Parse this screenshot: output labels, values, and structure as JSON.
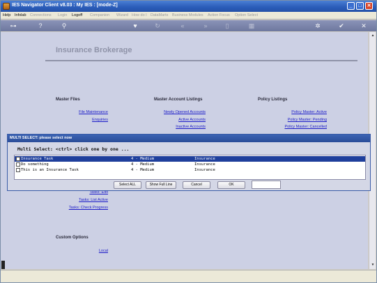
{
  "window": {
    "title": "IES Navigator Client v8.03 : My IES :      [mode-Z]"
  },
  "menu": [
    {
      "label": "Help",
      "dim": false
    },
    {
      "label": "Infolab",
      "dim": false
    },
    {
      "label": "Connections",
      "dim": true
    },
    {
      "label": "Login",
      "dim": true
    },
    {
      "label": "Logoff",
      "dim": false
    },
    {
      "label": "Companion",
      "dim": true
    },
    {
      "label": "Wizard",
      "dim": true
    },
    {
      "label": "How do I",
      "dim": true
    },
    {
      "label": "DataMarts",
      "dim": true
    },
    {
      "label": "Business Modules",
      "dim": true
    },
    {
      "label": "Action Focus",
      "dim": true
    },
    {
      "label": "Option Select",
      "dim": true
    }
  ],
  "page": {
    "title": "Insurance Brokerage",
    "sections": {
      "master_files": {
        "heading": "Master Files",
        "links": [
          "File Maintenance",
          "Enquiries"
        ]
      },
      "master_account_listings": {
        "heading": "Master Account Listings",
        "links": [
          "Newly Opened Accounts",
          "Active Accounts",
          "Inactive Accounts"
        ]
      },
      "policy_listings": {
        "heading": "Policy Listings",
        "links": [
          "Policy Master: Active",
          "Policy Master: Pending",
          "Policy Master: Cancelled"
        ]
      },
      "tasks": {
        "links": [
          "Tasks: Edit",
          "Tasks: List Active",
          "Tasks: Check Progress"
        ]
      },
      "custom_options": {
        "heading": "Custom Options",
        "links": [
          "Local"
        ]
      }
    }
  },
  "dialog": {
    "title": "MULTI SELECT: please select now",
    "heading": "Multi Select: <ctrl> click one by one ...",
    "rows": [
      {
        "task": "Insurance Task",
        "priority": "4 - Medium",
        "category": "Insurance",
        "selected": true
      },
      {
        "task": "Do something",
        "priority": "4 - Medium",
        "category": "Insurance",
        "selected": false
      },
      {
        "task": "This is an Insurance Task",
        "priority": "4 - Medium",
        "category": "Insurance",
        "selected": false
      }
    ],
    "buttons": {
      "select_all": "Select ALL",
      "show_full_line": "Show Full Line",
      "cancel": "Cancel",
      "ok": "OK"
    },
    "input_value": ""
  },
  "colors": {
    "titlebar": "#2a5bb8",
    "selected_row": "#1f3f9c",
    "link": "#1a1ac8",
    "content_bg": "#ccd0e4"
  }
}
